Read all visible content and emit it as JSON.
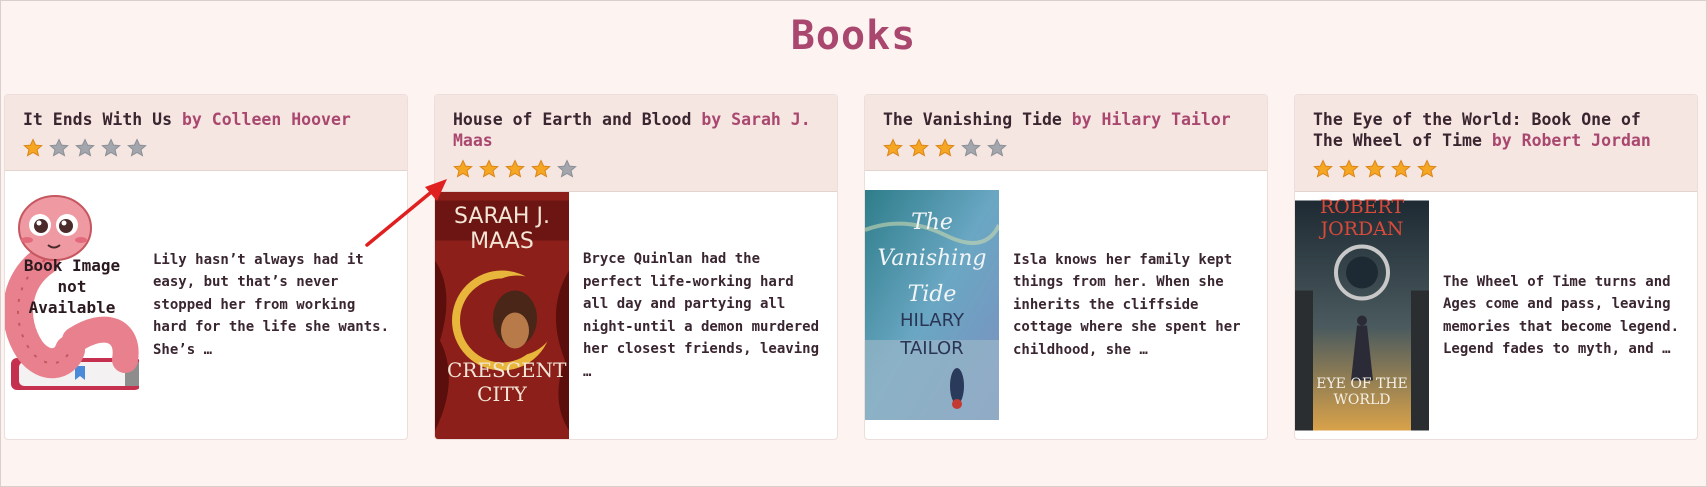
{
  "page": {
    "title": "Books"
  },
  "books": [
    {
      "title": "It Ends With Us",
      "author": "by Colleen Hoover",
      "rating": 1,
      "cover_placeholder": "Book Image not Available",
      "description": "Lily hasn’t always had it easy, but that’s never stopped her from working hard for the life she wants. She’s …"
    },
    {
      "title": "House of Earth and Blood",
      "author": "by Sarah J. Maas",
      "rating": 4,
      "cover": {
        "top": "SARAH J. MAAS",
        "bottom": "CRESCENT CITY"
      },
      "description": "Bryce Quinlan had the perfect life-working hard all day and partying all night-until a demon murdered her closest friends, leaving …"
    },
    {
      "title": "The Vanishing Tide",
      "author": "by Hilary Tailor",
      "rating": 3,
      "cover": {
        "top": "The Vanishing Tide",
        "bottom": "HILARY TAILOR"
      },
      "description": "Isla knows her family kept things from her. When she inherits the cliffside cottage where she spent her childhood, she …"
    },
    {
      "title": "The Eye of the World: Book One of The Wheel of Time",
      "author": "by Robert Jordan",
      "rating": 5,
      "cover": {
        "top": "ROBERT JORDAN",
        "bottom": "EYE OF THE WORLD"
      },
      "description": "The Wheel of Time turns and Ages come and pass, leaving memories that become legend. Legend fades to myth, and …"
    }
  ],
  "colors": {
    "accent": "#a9476f",
    "star_filled": "#f5a623",
    "star_empty": "#a3a7ad",
    "annotation_arrow": "#e02020"
  },
  "icons": {
    "star": "star-icon",
    "arrow": "annotation-arrow-icon"
  }
}
